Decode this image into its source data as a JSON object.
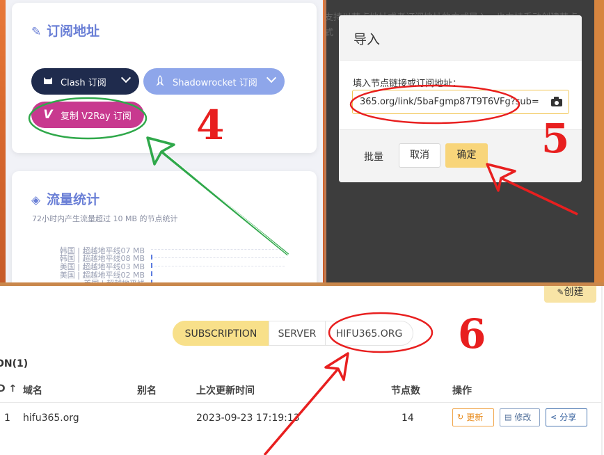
{
  "panel_subscribe": {
    "title": "订阅地址",
    "title_icon": "magic-wand-icon",
    "clash_label": "Clash 订阅",
    "shadowrocket_label": "Shadowrocket 订阅",
    "v2ray_label": "复制 V2Ray 订阅"
  },
  "panel_traffic": {
    "title": "流量统计",
    "title_icon": "paint-bucket-icon",
    "description": "72小时内产生流量超过 10 MB 的节点统计",
    "rows": [
      "韩国 | 超越地平线07 MB",
      "韩国 | 超越地平线08 MB",
      "美国 | 超越地平线03 MB",
      "美国 | 超越地平线02 MB",
      "美国 | 超越地平线"
    ]
  },
  "background_text": {
    "line1": "支持以节点地址或者订阅地址的方式导入，也支持手动创建节点",
    "line2": "式"
  },
  "import_dialog": {
    "title": "导入",
    "label": "填入节点链接或订阅地址：",
    "input_value": "365.org/link/5baFgmp87T9T6VFg?sub=",
    "batch_label": "批量",
    "cancel_label": "取消",
    "ok_label": "确定"
  },
  "subscription_page": {
    "create_label": "创建",
    "tabs": [
      "SUBSCRIPTION",
      "SERVER",
      "HIFU365.ORG"
    ],
    "table_title": "ON(1)",
    "headers": {
      "id": "D ↑",
      "domain": "域名",
      "alias": "别名",
      "updated": "上次更新时间",
      "nodes": "节点数",
      "actions": "操作"
    },
    "rows": [
      {
        "id": "1",
        "domain": "hifu365.org",
        "alias": "",
        "updated": "2023-09-23 17:19:13",
        "nodes": "14",
        "update_label": "更新",
        "edit_label": "修改",
        "share_label": "分享"
      }
    ]
  },
  "annotations": {
    "step_4": "4",
    "step_5": "5",
    "step_6": "6"
  },
  "colors": {
    "accent_yellow": "#f8d57a",
    "clash_pill": "#1f2b4d",
    "shadowrocket_pill": "#8ea6ea",
    "v2ray_pill": "#c8398f",
    "annotation_red": "#e81f1f",
    "annotation_green": "#2fa84a"
  }
}
